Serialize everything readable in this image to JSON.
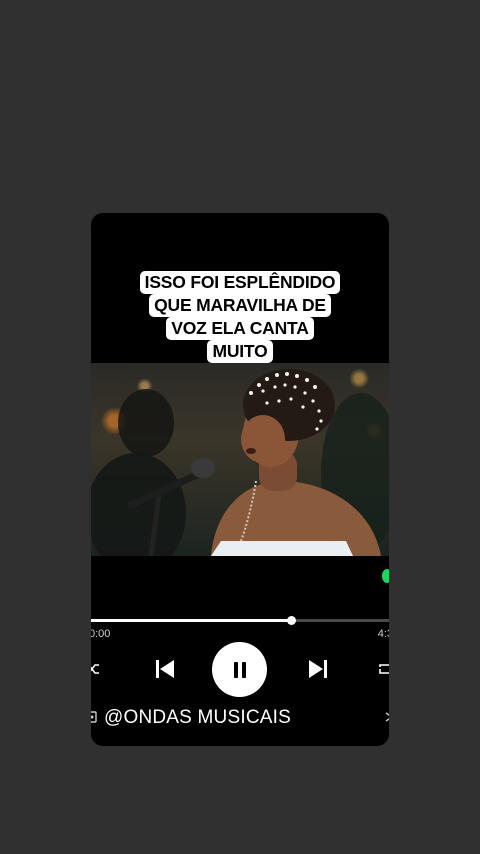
{
  "caption": {
    "lines": [
      "ISSO FOI ESPLÊNDIDO",
      "QUE MARAVILHA DE",
      "VOZ ELA CANTA",
      "MUITO"
    ]
  },
  "player": {
    "elapsed": "0:00",
    "total": "4:3",
    "progress": 0.67
  },
  "account": {
    "handle": "@ONDAS MUSICAIS"
  },
  "colors": {
    "background": "#303030",
    "card": "#000000",
    "accent": "#1ed760"
  },
  "icons": [
    "shuffle-icon",
    "previous-icon",
    "pause-icon",
    "next-icon",
    "repeat-icon"
  ]
}
